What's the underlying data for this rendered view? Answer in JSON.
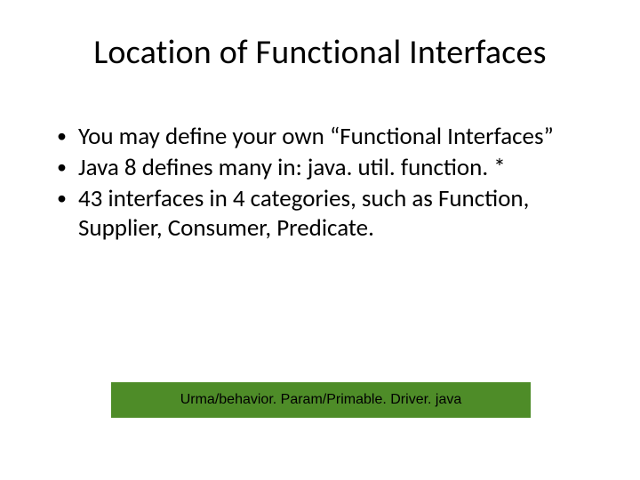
{
  "title": "Location of Functional Interfaces",
  "bullets": [
    "You may define your own “Functional Interfaces”",
    "Java 8 defines many in: java. util. function. *",
    "43 interfaces in 4 categories, such as Function, Supplier, Consumer, Predicate."
  ],
  "code_reference": "Urma/behavior. Param/Primable. Driver. java"
}
